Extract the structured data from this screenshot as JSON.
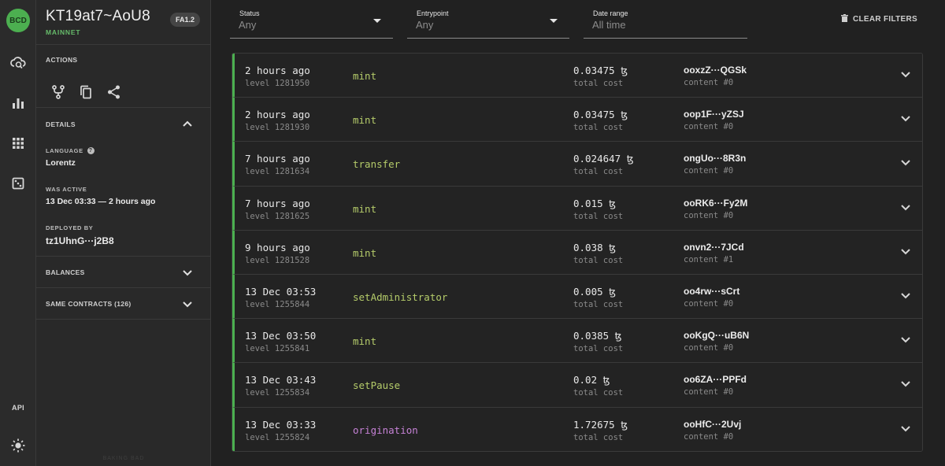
{
  "rail": {
    "logo": "BCD",
    "api_label": "API"
  },
  "contract": {
    "title": "KT19at7~AoU8",
    "network": "MAINNET",
    "badge": "FA1.2"
  },
  "sidebar": {
    "actions_label": "ACTIONS",
    "details_label": "DETAILS",
    "language_label": "LANGUAGE",
    "language_value": "Lorentz",
    "active_label": "WAS ACTIVE",
    "active_value": "13 Dec 03:33 — 2 hours ago",
    "deployed_label": "DEPLOYED BY",
    "deployed_value": "tz1UhnG···j2B8",
    "balances_label": "BALANCES",
    "same_contracts_label": "SAME CONTRACTS (126)",
    "footer": "BAKING BAD"
  },
  "filters": {
    "status": {
      "label": "Status",
      "value": "Any"
    },
    "entrypoint": {
      "label": "Entrypoint",
      "value": "Any"
    },
    "date_range": {
      "label": "Date range",
      "value": "All time"
    },
    "clear_label": "CLEAR FILTERS"
  },
  "operations": [
    {
      "time": "2 hours ago",
      "level": "level 1281950",
      "entrypoint": "mint",
      "cost": "0.03475 ꜩ",
      "cost_label": "total cost",
      "hash": "ooxzZ···QGSk",
      "content": "content #0"
    },
    {
      "time": "2 hours ago",
      "level": "level 1281930",
      "entrypoint": "mint",
      "cost": "0.03475 ꜩ",
      "cost_label": "total cost",
      "hash": "oop1F···yZSJ",
      "content": "content #0"
    },
    {
      "time": "7 hours ago",
      "level": "level 1281634",
      "entrypoint": "transfer",
      "cost": "0.024647 ꜩ",
      "cost_label": "total cost",
      "hash": "ongUo···8R3n",
      "content": "content #0"
    },
    {
      "time": "7 hours ago",
      "level": "level 1281625",
      "entrypoint": "mint",
      "cost": "0.015 ꜩ",
      "cost_label": "total cost",
      "hash": "ooRK6···Fy2M",
      "content": "content #0"
    },
    {
      "time": "9 hours ago",
      "level": "level 1281528",
      "entrypoint": "mint",
      "cost": "0.038 ꜩ",
      "cost_label": "total cost",
      "hash": "onvn2···7JCd",
      "content": "content #1"
    },
    {
      "time": "13 Dec 03:53",
      "level": "level 1255844",
      "entrypoint": "setAdministrator",
      "cost": "0.005 ꜩ",
      "cost_label": "total cost",
      "hash": "oo4rw···sCrt",
      "content": "content #0"
    },
    {
      "time": "13 Dec 03:50",
      "level": "level 1255841",
      "entrypoint": "mint",
      "cost": "0.0385 ꜩ",
      "cost_label": "total cost",
      "hash": "ooKgQ···uB6N",
      "content": "content #0"
    },
    {
      "time": "13 Dec 03:43",
      "level": "level 1255834",
      "entrypoint": "setPause",
      "cost": "0.02 ꜩ",
      "cost_label": "total cost",
      "hash": "oo6ZA···PPFd",
      "content": "content #0"
    },
    {
      "time": "13 Dec 03:33",
      "level": "level 1255824",
      "entrypoint": "origination",
      "cost": "1.72675 ꜩ",
      "cost_label": "total cost",
      "hash": "ooHfC···2Uvj",
      "content": "content #0"
    }
  ],
  "colors": {
    "accent": "#4caf50",
    "entrypoint": "#b5cc6a",
    "origination": "#c682d6"
  }
}
